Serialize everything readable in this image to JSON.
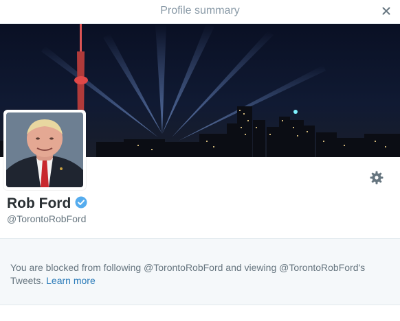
{
  "modal": {
    "title": "Profile summary",
    "close_icon": "close-icon"
  },
  "profile": {
    "full_name": "Rob Ford",
    "screen_name": "@TorontoRobFord",
    "verified": true,
    "verified_icon": "verified-badge-icon",
    "settings_icon": "gear-icon"
  },
  "notice": {
    "text": "You are blocked from following @TorontoRobFord and viewing @TorontoRobFord's Tweets.",
    "link_label": "Learn more"
  },
  "colors": {
    "verified": "#55acee",
    "link": "#2b7bb9",
    "muted": "#8899a6",
    "notice_bg": "#f5f8fa"
  }
}
